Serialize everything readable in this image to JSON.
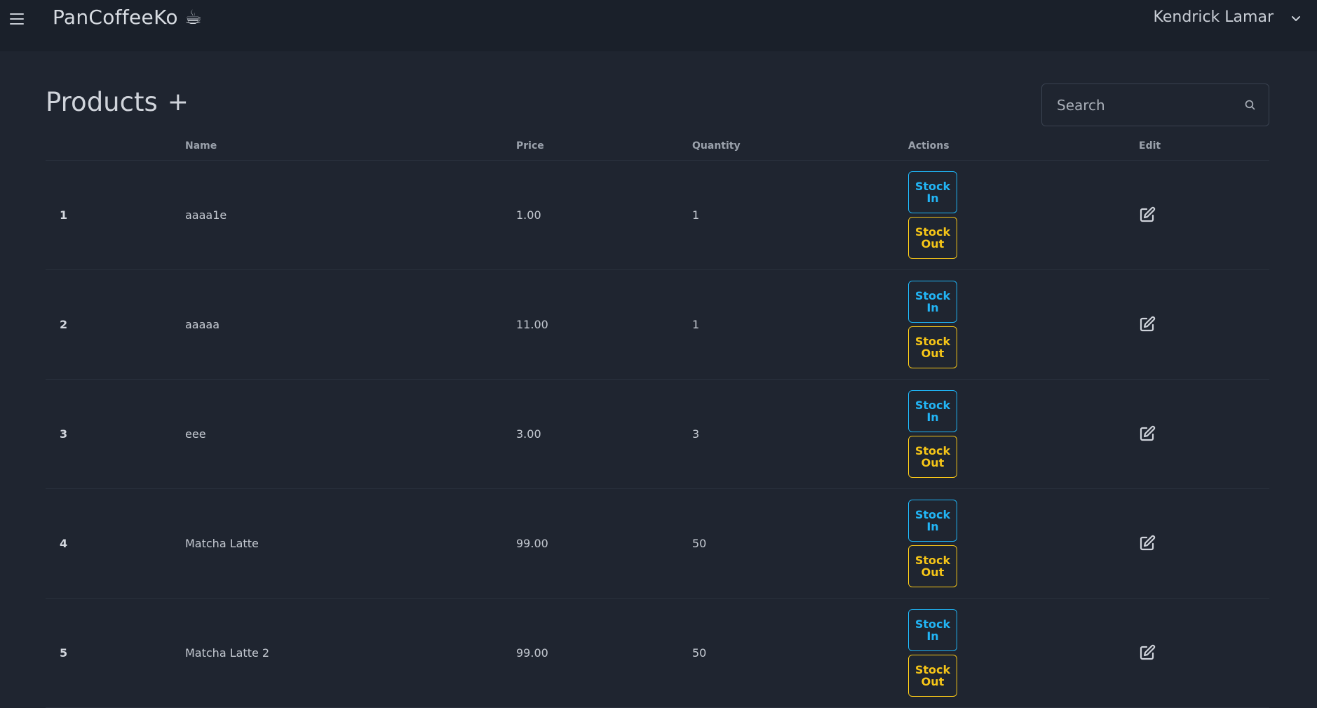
{
  "app": {
    "brand": "PanCoffeeKo ☕",
    "user_name": "Kendrick Lamar"
  },
  "page": {
    "title": "Products",
    "add_label": "+"
  },
  "search": {
    "placeholder": "Search"
  },
  "table": {
    "headers": {
      "index": "",
      "name": "Name",
      "price": "Price",
      "quantity": "Quantity",
      "actions": "Actions",
      "edit": "Edit"
    },
    "stock_in_label": "Stock In",
    "stock_out_label": "Stock Out",
    "rows": [
      {
        "index": "1",
        "name": "aaaa1e",
        "price": "1.00",
        "quantity": "1"
      },
      {
        "index": "2",
        "name": "aaaaa",
        "price": "11.00",
        "quantity": "1"
      },
      {
        "index": "3",
        "name": "eee",
        "price": "3.00",
        "quantity": "3"
      },
      {
        "index": "4",
        "name": "Matcha Latte",
        "price": "99.00",
        "quantity": "50"
      },
      {
        "index": "5",
        "name": "Matcha Latte 2",
        "price": "99.00",
        "quantity": "50"
      }
    ]
  },
  "colors": {
    "background": "#1f2530",
    "topbar": "#1a202a",
    "stock_in": "#1fb2f2",
    "stock_out": "#f5c518"
  },
  "icons": {
    "menu": "hamburger-menu-icon",
    "user_dropdown": "chevron-down-icon",
    "search": "search-icon",
    "edit": "edit-icon"
  }
}
